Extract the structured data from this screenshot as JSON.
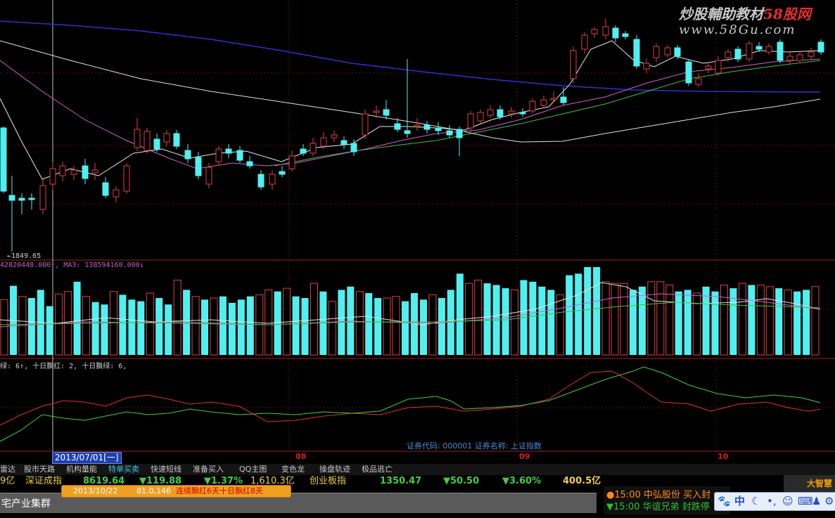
{
  "watermark": {
    "title_left": "炒股輔助教材",
    "title_right": "58股网",
    "url": "www.58Gu.com"
  },
  "price_panel": {
    "low_label": "←1849.65"
  },
  "volume_panel": {
    "label": "42820448.000↑, MA3: 138594160.000↓",
    "bars": [
      {
        "v": 68,
        "c": "u"
      },
      {
        "v": 85,
        "c": "d"
      },
      {
        "v": 72,
        "c": "u"
      },
      {
        "v": 70,
        "c": "d"
      },
      {
        "v": 80,
        "c": "d"
      },
      {
        "v": 60,
        "c": "d"
      },
      {
        "v": 75,
        "c": "u"
      },
      {
        "v": 78,
        "c": "u"
      },
      {
        "v": 90,
        "c": "d"
      },
      {
        "v": 72,
        "c": "u"
      },
      {
        "v": 65,
        "c": "d"
      },
      {
        "v": 62,
        "c": "d"
      },
      {
        "v": 78,
        "c": "u"
      },
      {
        "v": 74,
        "c": "d"
      },
      {
        "v": 68,
        "c": "d"
      },
      {
        "v": 66,
        "c": "d"
      },
      {
        "v": 76,
        "c": "u"
      },
      {
        "v": 70,
        "c": "d"
      },
      {
        "v": 62,
        "c": "d"
      },
      {
        "v": 92,
        "c": "u"
      },
      {
        "v": 80,
        "c": "d"
      },
      {
        "v": 72,
        "c": "u"
      },
      {
        "v": 68,
        "c": "d"
      },
      {
        "v": 70,
        "c": "u"
      },
      {
        "v": 72,
        "c": "d"
      },
      {
        "v": 64,
        "c": "d"
      },
      {
        "v": 68,
        "c": "d"
      },
      {
        "v": 72,
        "c": "d"
      },
      {
        "v": 74,
        "c": "u"
      },
      {
        "v": 80,
        "c": "u"
      },
      {
        "v": 78,
        "c": "d"
      },
      {
        "v": 82,
        "c": "u"
      },
      {
        "v": 72,
        "c": "d"
      },
      {
        "v": 70,
        "c": "d"
      },
      {
        "v": 88,
        "c": "u"
      },
      {
        "v": 78,
        "c": "d"
      },
      {
        "v": 66,
        "c": "u"
      },
      {
        "v": 80,
        "c": "d"
      },
      {
        "v": 84,
        "c": "d"
      },
      {
        "v": 78,
        "c": "u"
      },
      {
        "v": 76,
        "c": "d"
      },
      {
        "v": 70,
        "c": "d"
      },
      {
        "v": 70,
        "c": "u"
      },
      {
        "v": 72,
        "c": "u"
      },
      {
        "v": 66,
        "c": "d"
      },
      {
        "v": 76,
        "c": "d"
      },
      {
        "v": 68,
        "c": "d"
      },
      {
        "v": 74,
        "c": "u"
      },
      {
        "v": 70,
        "c": "d"
      },
      {
        "v": 80,
        "c": "d"
      },
      {
        "v": 100,
        "c": "d"
      },
      {
        "v": 88,
        "c": "u"
      },
      {
        "v": 92,
        "c": "u"
      },
      {
        "v": 88,
        "c": "d"
      },
      {
        "v": 86,
        "c": "d"
      },
      {
        "v": 82,
        "c": "d"
      },
      {
        "v": 80,
        "c": "u"
      },
      {
        "v": 92,
        "c": "d"
      },
      {
        "v": 90,
        "c": "d"
      },
      {
        "v": 84,
        "c": "d"
      },
      {
        "v": 80,
        "c": "d"
      },
      {
        "v": 74,
        "c": "u"
      },
      {
        "v": 98,
        "c": "d"
      },
      {
        "v": 100,
        "c": "d"
      },
      {
        "v": 108,
        "c": "d"
      },
      {
        "v": 108,
        "c": "d"
      },
      {
        "v": 90,
        "c": "u"
      },
      {
        "v": 88,
        "c": "u"
      },
      {
        "v": 88,
        "c": "u"
      },
      {
        "v": 80,
        "c": "d"
      },
      {
        "v": 84,
        "c": "d"
      },
      {
        "v": 90,
        "c": "u"
      },
      {
        "v": 90,
        "c": "u"
      },
      {
        "v": 86,
        "c": "u"
      },
      {
        "v": 78,
        "c": "d"
      },
      {
        "v": 80,
        "c": "d"
      },
      {
        "v": 76,
        "c": "u"
      },
      {
        "v": 84,
        "c": "d"
      },
      {
        "v": 78,
        "c": "d"
      },
      {
        "v": 86,
        "c": "u"
      },
      {
        "v": 82,
        "c": "d"
      },
      {
        "v": 88,
        "c": "u"
      },
      {
        "v": 86,
        "c": "d"
      },
      {
        "v": 86,
        "c": "u"
      },
      {
        "v": 84,
        "c": "u"
      },
      {
        "v": 82,
        "c": "d"
      },
      {
        "v": 80,
        "c": "u"
      },
      {
        "v": 78,
        "c": "d"
      },
      {
        "v": 80,
        "c": "d"
      },
      {
        "v": 84,
        "c": "u"
      }
    ]
  },
  "osc_panel": {
    "label": "绿: 6↑, 十日飘红: 2, 十日飘绿: 6,"
  },
  "status": {
    "info": "证券代码: 000001 证券名称: 上证指数",
    "date_box": "2013/07/01[一]",
    "months": [
      "08",
      "09",
      "10"
    ]
  },
  "tabs": [
    "雷达",
    "股市天路",
    "机构量能",
    "特单买卖",
    "快速短线",
    "准备买入",
    "QQ主图",
    "变色龙",
    "操盘轨迹",
    "极品逃亡"
  ],
  "ticker": {
    "prefix": "9亿",
    "name1": "深证成指",
    "value1": "8619.64",
    "chg1": "▼119.88",
    "pct1": "▼1.37%",
    "amt1": "1,610.3亿",
    "name2": "创业板指",
    "value2": "1350.47",
    "chg2": "▼50.50",
    "pct2": "▼3.60%",
    "amt2": "400.5亿"
  },
  "note": {
    "date": "2013/10/22",
    "value": "81.0,146",
    "text": "连续飘红6天十日飘红8天"
  },
  "sector": {
    "name": "宅产业集群"
  },
  "alerts": [
    {
      "time": "●15:00",
      "text": "中弘股份 买入封"
    },
    {
      "time": "▼15:00",
      "text": "华谊兄弟 封跌停"
    }
  ],
  "logo": {
    "text": "大智慧"
  },
  "ime": {
    "lang": "中"
  },
  "colors": {
    "up": "#e04040",
    "down": "#50f0f0",
    "ma_long": "#3030d0",
    "ma_mid": "#d060d0",
    "ma_green": "#40c040",
    "ma_white": "#e0e0e0"
  }
}
